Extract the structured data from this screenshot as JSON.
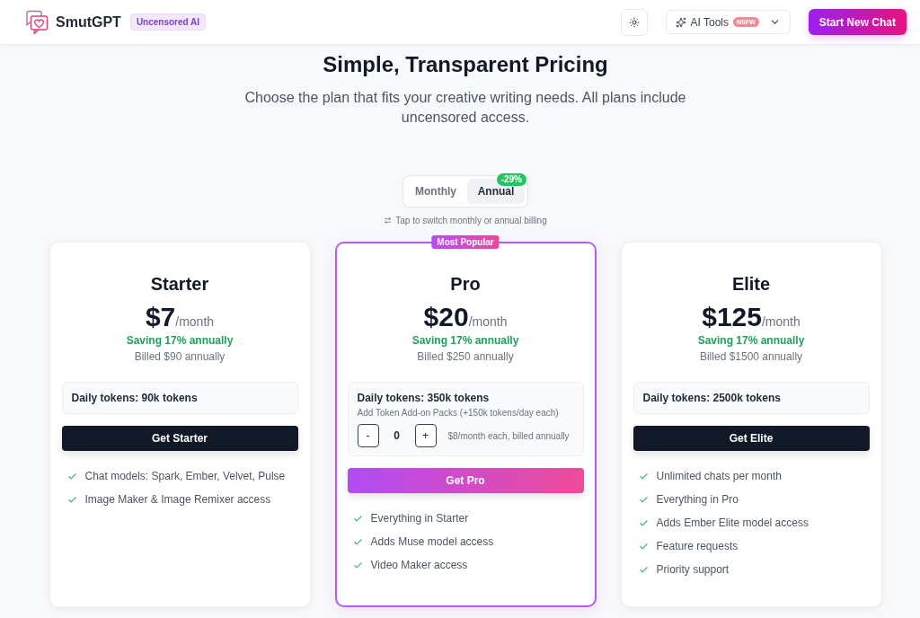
{
  "header": {
    "brand": "SmutGPT",
    "brand_badge": "Uncensored AI",
    "ai_tools": {
      "label": "AI Tools",
      "badge": "NSFW"
    },
    "cta": "Start New Chat"
  },
  "hero": {
    "title": "Simple, Transparent Pricing",
    "subtitle": "Choose the plan that fits your creative writing needs. All plans include uncensored access."
  },
  "billing_toggle": {
    "options": [
      {
        "label": "Monthly",
        "selected": false
      },
      {
        "label": "Annual",
        "selected": true,
        "badge": "-29%"
      }
    ],
    "hint": "Tap to switch monthly or annual billing"
  },
  "plans": [
    {
      "name": "Starter",
      "featured": false,
      "price": "$7",
      "period": "/month",
      "saving": "Saving 17% annually",
      "billed": "Billed $90 annually",
      "tokens": "Daily tokens: 90k tokens",
      "button": "Get Starter",
      "features": [
        "Chat models: Spark, Ember, Velvet, Pulse",
        "Image Maker & Image Remixer access"
      ]
    },
    {
      "name": "Pro",
      "featured": true,
      "ribbon": "Most Popular",
      "price": "$20",
      "period": "/month",
      "saving": "Saving 17% annually",
      "billed": "Billed $250 annually",
      "tokens": "Daily tokens: 350k tokens",
      "addon": {
        "label": "Add Token Add-on Packs (+150k tokens/day each)",
        "decrement": "-",
        "count": "0",
        "increment": "+",
        "note": "$8/month each, billed annually"
      },
      "button": "Get Pro",
      "features": [
        "Everything in Starter",
        "Adds Muse model access",
        "Video Maker access"
      ]
    },
    {
      "name": "Elite",
      "featured": false,
      "price": "$125",
      "period": "/month",
      "saving": "Saving 17% annually",
      "billed": "Billed $1500 annually",
      "tokens": "Daily tokens: 2500k tokens",
      "button": "Get Elite",
      "features": [
        "Unlimited chats per month",
        "Everything in Pro",
        "Adds Ember Elite model access",
        "Feature requests",
        "Priority support"
      ]
    }
  ]
}
